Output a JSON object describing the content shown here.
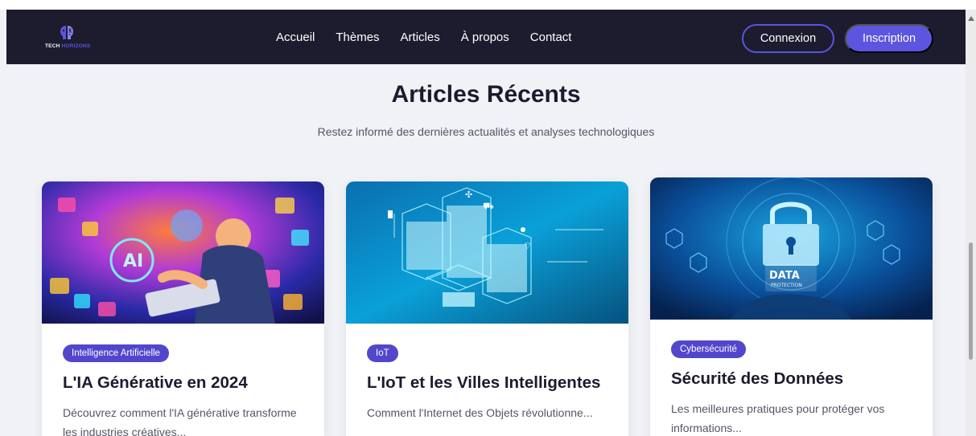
{
  "brand": {
    "logo_word_1": "TECH",
    "logo_word_2": "HORIZONS",
    "accent_color": "#5b55e0",
    "nav_bg": "#1c1c2e"
  },
  "nav": {
    "links": [
      {
        "label": "Accueil"
      },
      {
        "label": "Thèmes"
      },
      {
        "label": "Articles"
      },
      {
        "label": "À propos"
      },
      {
        "label": "Contact"
      }
    ],
    "login_label": "Connexion",
    "signup_label": "Inscription"
  },
  "section": {
    "title": "Articles Récents",
    "subtitle": "Restez informé des dernières actualités et analyses technologiques"
  },
  "articles": [
    {
      "category": "Intelligence Artificielle",
      "title": "L'IA Générative en 2024",
      "description": "Découvrez comment l'IA générative transforme les industries créatives..."
    },
    {
      "category": "IoT",
      "title": "L'IoT et les Villes Intelligentes",
      "description": "Comment l'Internet des Objets révolutionne..."
    },
    {
      "category": "Cybersécurité",
      "title": "Sécurité des Données",
      "description": "Les meilleures pratiques pour protéger vos informations...",
      "image_text_1": "DATA",
      "image_text_2": "PROTECTION"
    }
  ]
}
